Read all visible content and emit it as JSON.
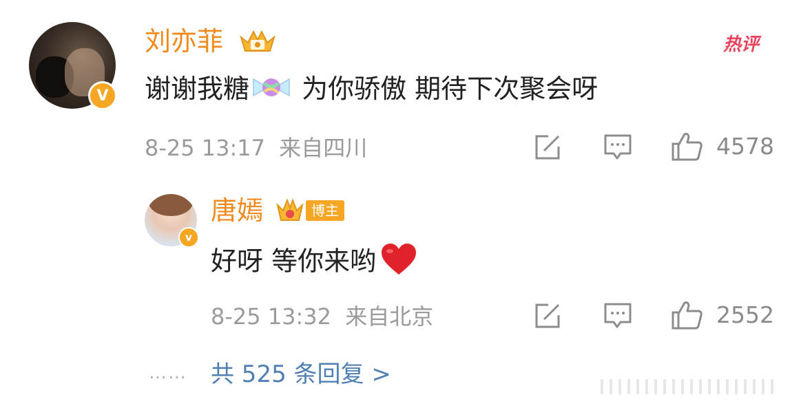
{
  "comment": {
    "username": "刘亦菲",
    "text_before": "谢谢我糖",
    "text_after": " 为你骄傲 期待下次聚会呀",
    "date": "8-25 13:17",
    "location": "来自四川",
    "likes": "4578",
    "hot_label": "热评",
    "verified_badge": "V"
  },
  "reply": {
    "username": "唐嫣",
    "tag": "博主",
    "text": "好呀 等你来哟",
    "date": "8-25 13:32",
    "location": "来自北京",
    "likes": "2552",
    "verified_badge": "v"
  },
  "more": {
    "dots": "……",
    "label": "共 525 条回复 >"
  },
  "icons": [
    "repost-icon",
    "comment-icon",
    "like-icon",
    "candy-emoji-icon",
    "heart-emoji-icon",
    "crown-icon"
  ],
  "colors": {
    "username": "#f08a1d",
    "text": "#222222",
    "meta": "#9a9a9a",
    "link": "#4f7fb3",
    "hot": "#e8435d",
    "badge": "#f5a623"
  }
}
